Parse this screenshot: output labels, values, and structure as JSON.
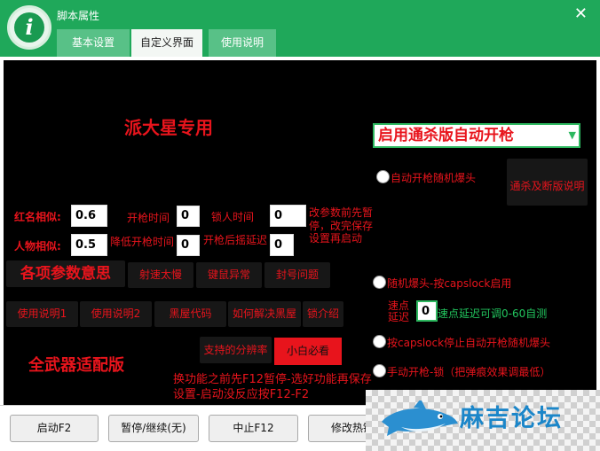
{
  "window": {
    "title": "脚本属性",
    "close_glyph": "✕"
  },
  "tabs": [
    {
      "label": "基本设置",
      "active": false
    },
    {
      "label": "自定义界面",
      "active": true
    },
    {
      "label": "使用说明",
      "active": false
    }
  ],
  "panel": {
    "heading": "派大星专用",
    "subheading": "全武器适配版",
    "mode_select": {
      "value": "启用通杀版自动开枪",
      "arrow": "▼"
    },
    "red_name_label": "红名相似:",
    "red_name_value": "0.6",
    "person_label": "人物相似:",
    "person_value": "0.5",
    "fire_time_label": "开枪时间",
    "fire_time_value": "0",
    "lock_time_label": "锁人时间",
    "lock_time_value": "0",
    "lower_fire_label": "降低开枪时间",
    "lower_fire_value": "0",
    "post_fire_delay_label": "开枪后摇延迟",
    "post_fire_delay_value": "0",
    "save_note": "改参数前先暂停，改完保存设置再启动",
    "params_title": "各项参数意思",
    "buttons_row1": [
      "射速太慢",
      "键鼠异常",
      "封号问题"
    ],
    "buttons_row2": [
      "使用说明1",
      "使用说明2",
      "黑屋代码",
      "如何解决黑屋",
      "锁介绍"
    ],
    "resolution_button": "支持的分辨率",
    "newbie_button": "小白必看",
    "auto_fire_random_burst": "自动开枪随机爆头",
    "kill_version_button": "通杀及断版说明",
    "random_burst_caps": "随机爆头-按capslock启用",
    "speed_delay_label": "速点延迟",
    "speed_delay_value": "0",
    "speed_delay_hint": "速点延迟可调0-60自测",
    "caps_stop": "按capslock停止自动开枪随机爆头",
    "manual_fire": "手动开枪-锁（把弹痕效果调最低）",
    "switch_note": "换功能之前先F12暂停-选好功能再保存设置-启动没反应按F12-F2"
  },
  "bottom_buttons": [
    "启动F2",
    "暂停/继续(无)",
    "中止F12",
    "修改热键"
  ],
  "watermark": {
    "text": "麻吉论坛"
  },
  "colors": {
    "accent_green": "#1fa85a",
    "text_red": "#e8141c",
    "hint_green": "#22c55e"
  },
  "icons": {
    "logo": "info-icon",
    "close": "close-icon"
  }
}
